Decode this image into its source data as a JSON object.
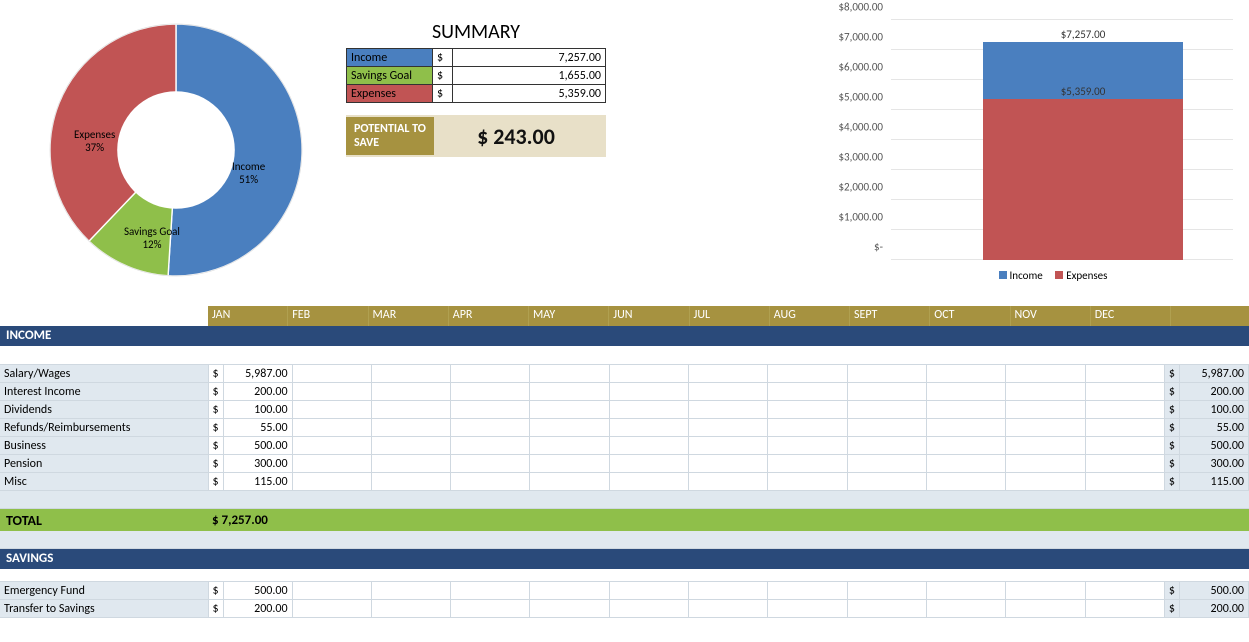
{
  "summary": {
    "title": "SUMMARY",
    "rows": [
      {
        "label": "Income",
        "currency": "$",
        "amount": "7,257.00",
        "class": "cat-income"
      },
      {
        "label": "Savings Goal",
        "currency": "$",
        "amount": "1,655.00",
        "class": "cat-savings"
      },
      {
        "label": "Expenses",
        "currency": "$",
        "amount": "5,359.00",
        "class": "cat-expenses"
      }
    ],
    "potential": {
      "label": "POTENTIAL TO SAVE",
      "value": "$   243.00"
    }
  },
  "chart_data": [
    {
      "type": "pie",
      "title": "",
      "series": [
        {
          "name": "Income",
          "value": 51,
          "pct": "51%",
          "color": "#4a7fbf"
        },
        {
          "name": "Savings Goal",
          "value": 12,
          "pct": "12%",
          "color": "#8fbf4a"
        },
        {
          "name": "Expenses",
          "value": 37,
          "pct": "37%",
          "color": "#c15454"
        }
      ]
    },
    {
      "type": "bar",
      "categories": [
        ""
      ],
      "series": [
        {
          "name": "Income",
          "values": [
            7257
          ],
          "label": "$7,257.00",
          "color": "#4a7fbf"
        },
        {
          "name": "Expenses",
          "values": [
            5359
          ],
          "label": "$5,359.00",
          "color": "#c15454"
        }
      ],
      "ylim": [
        0,
        8000
      ],
      "yticks": [
        "$-",
        "$1,000.00",
        "$2,000.00",
        "$3,000.00",
        "$4,000.00",
        "$5,000.00",
        "$6,000.00",
        "$7,000.00",
        "$8,000.00"
      ],
      "legend": [
        "Income",
        "Expenses"
      ]
    }
  ],
  "months": [
    "JAN",
    "FEB",
    "MAR",
    "APR",
    "MAY",
    "JUN",
    "JUL",
    "AUG",
    "SEPT",
    "OCT",
    "NOV",
    "DEC"
  ],
  "sections": {
    "income": {
      "header": "INCOME",
      "rows": [
        {
          "label": "Salary/Wages",
          "jan": "5,987.00",
          "total": "5,987.00"
        },
        {
          "label": "Interest Income",
          "jan": "200.00",
          "total": "200.00"
        },
        {
          "label": "Dividends",
          "jan": "100.00",
          "total": "100.00"
        },
        {
          "label": "Refunds/Reimbursements",
          "jan": "55.00",
          "total": "55.00"
        },
        {
          "label": "Business",
          "jan": "500.00",
          "total": "500.00"
        },
        {
          "label": "Pension",
          "jan": "300.00",
          "total": "300.00"
        },
        {
          "label": "Misc",
          "jan": "115.00",
          "total": "115.00"
        }
      ],
      "total": {
        "label": "TOTAL",
        "value": "$  7,257.00"
      }
    },
    "savings": {
      "header": "SAVINGS",
      "rows": [
        {
          "label": "Emergency Fund",
          "jan": "500.00",
          "total": "500.00"
        },
        {
          "label": "Transfer to Savings",
          "jan": "200.00",
          "total": "200.00"
        }
      ]
    }
  },
  "currency_symbol": "$"
}
